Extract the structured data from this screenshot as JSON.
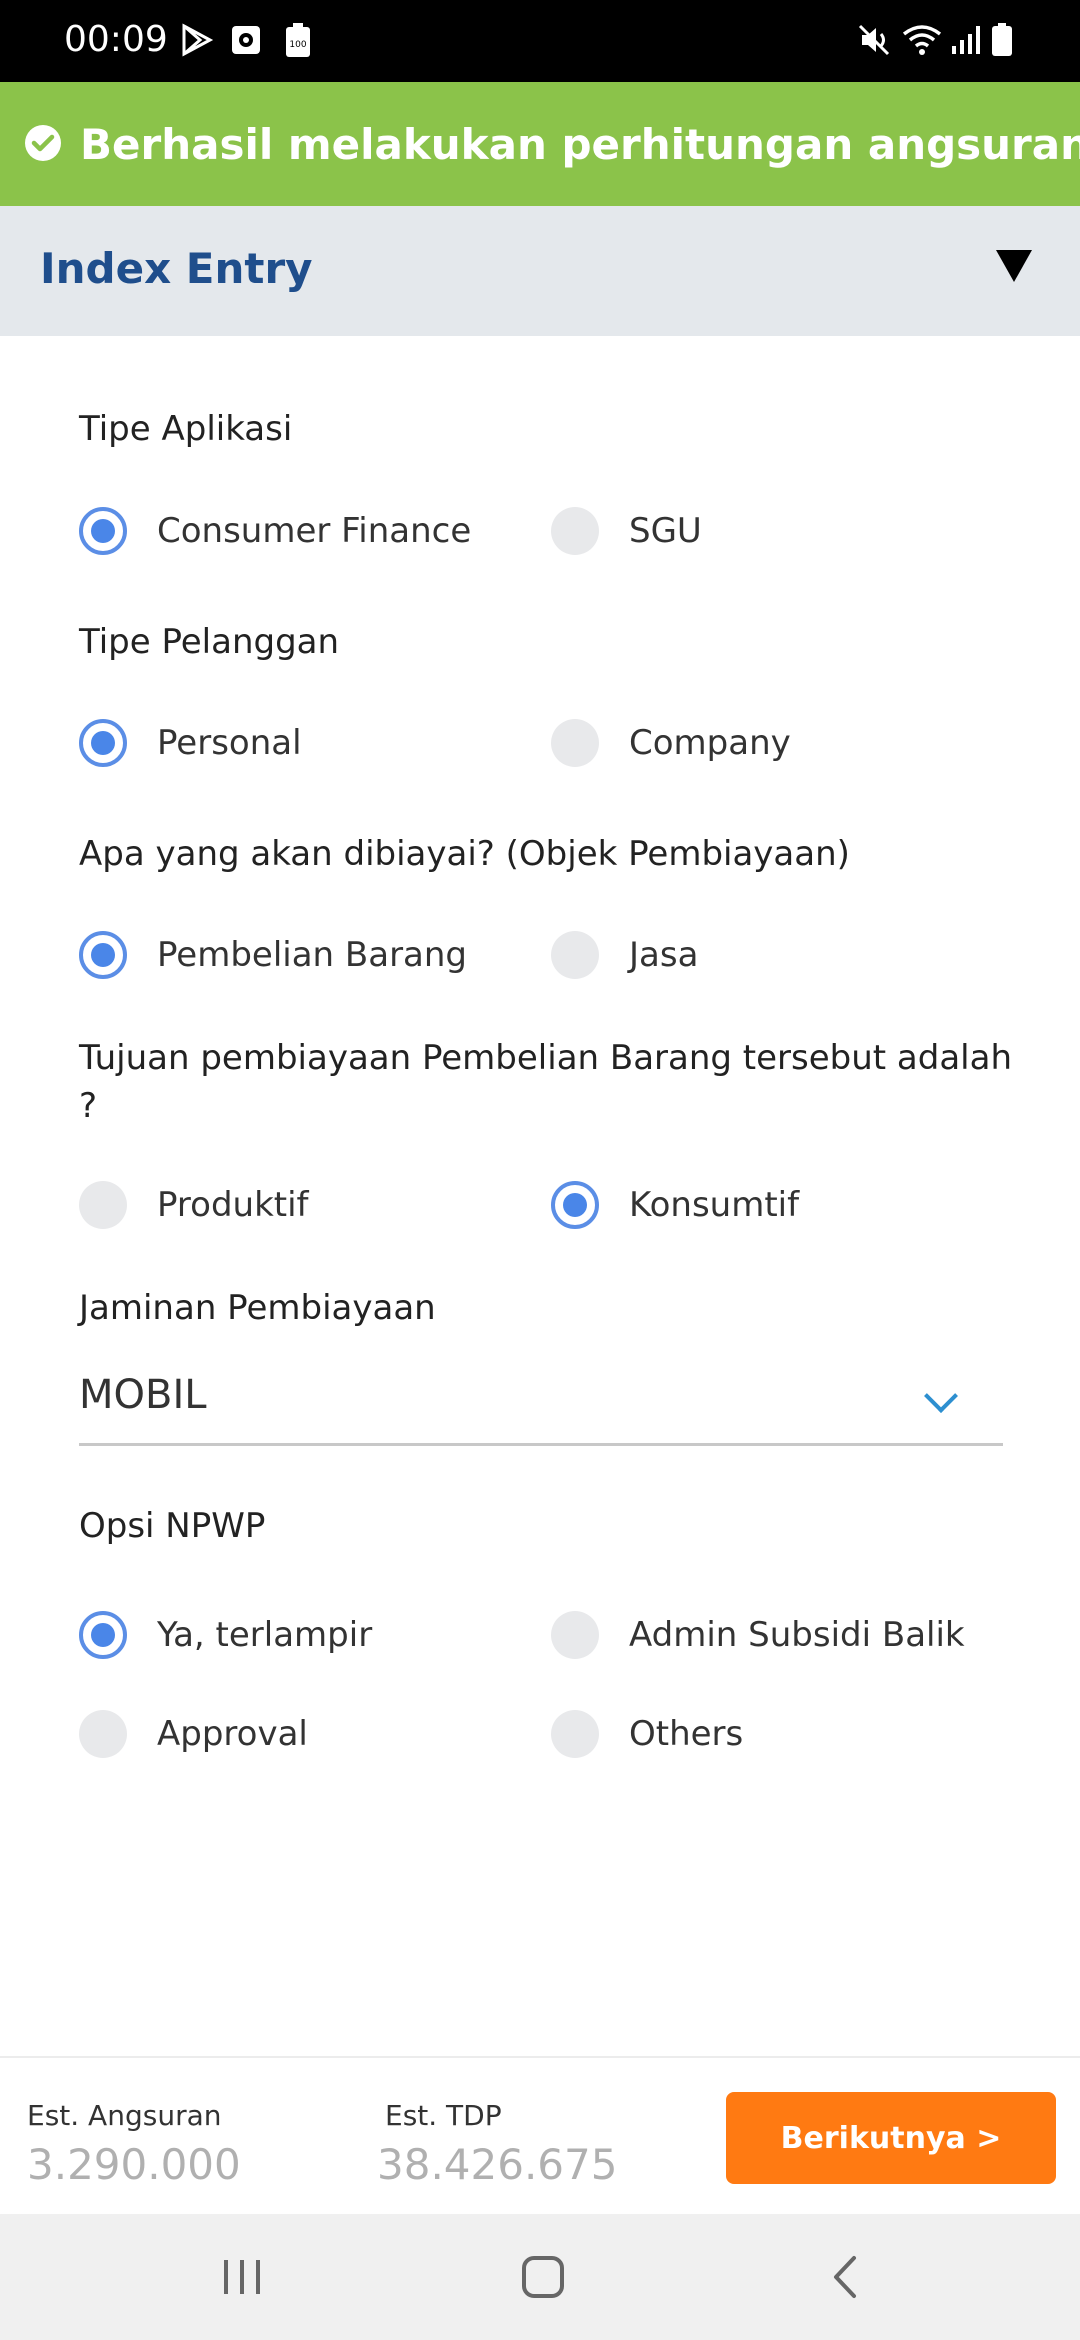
{
  "status_bar": {
    "time": "00:09",
    "icons_left": [
      "play-store-icon",
      "screen-record-icon",
      "battery-saver-icon"
    ],
    "icons_right": [
      "mute-icon",
      "wifi-icon",
      "signal-icon",
      "battery-icon"
    ]
  },
  "banner": {
    "icon": "check-circle-icon",
    "text": "Berhasil melakukan perhitungan angsuran!",
    "color": "#8bc34a"
  },
  "section": {
    "title": "Index Entry",
    "toggle_icon": "triangle-down-icon"
  },
  "form": {
    "tipe_aplikasi": {
      "label": "Tipe Aplikasi",
      "options": [
        {
          "label": "Consumer Finance",
          "selected": true
        },
        {
          "label": "SGU",
          "selected": false
        }
      ]
    },
    "tipe_pelanggan": {
      "label": "Tipe Pelanggan",
      "options": [
        {
          "label": "Personal",
          "selected": true
        },
        {
          "label": "Company",
          "selected": false
        }
      ]
    },
    "objek_pembiayaan": {
      "label": "Apa yang akan dibiayai? (Objek Pembiayaan)",
      "options": [
        {
          "label": "Pembelian Barang",
          "selected": true
        },
        {
          "label": "Jasa",
          "selected": false
        }
      ]
    },
    "tujuan_pembiayaan": {
      "label_line1": "Tujuan pembiayaan Pembelian Barang tersebut adalah",
      "label_line2": "?",
      "options": [
        {
          "label": "Produktif",
          "selected": false
        },
        {
          "label": "Konsumtif",
          "selected": true
        }
      ]
    },
    "jaminan": {
      "label": "Jaminan Pembiayaan",
      "value": "MOBIL",
      "icon": "chevron-down-icon"
    },
    "npwp": {
      "label": "Opsi NPWP",
      "options": [
        {
          "label": "Ya, terlampir",
          "selected": true
        },
        {
          "label": "Admin Subsidi Balik",
          "selected": false
        },
        {
          "label": "Approval",
          "selected": false
        },
        {
          "label": "Others",
          "selected": false
        }
      ]
    }
  },
  "bottom_bar": {
    "angsuran_label": "Est. Angsuran",
    "angsuran_value": "3.290.000",
    "tdp_label": "Est. TDP",
    "tdp_value": "38.426.675",
    "next_label": "Berikutnya >",
    "next_color": "#ff7a12"
  },
  "nav_bar": {
    "icons": [
      "recent-apps-icon",
      "home-icon",
      "back-icon"
    ]
  },
  "colors": {
    "accent_blue": "#4a86e8",
    "title_blue": "#1f4e8c"
  }
}
